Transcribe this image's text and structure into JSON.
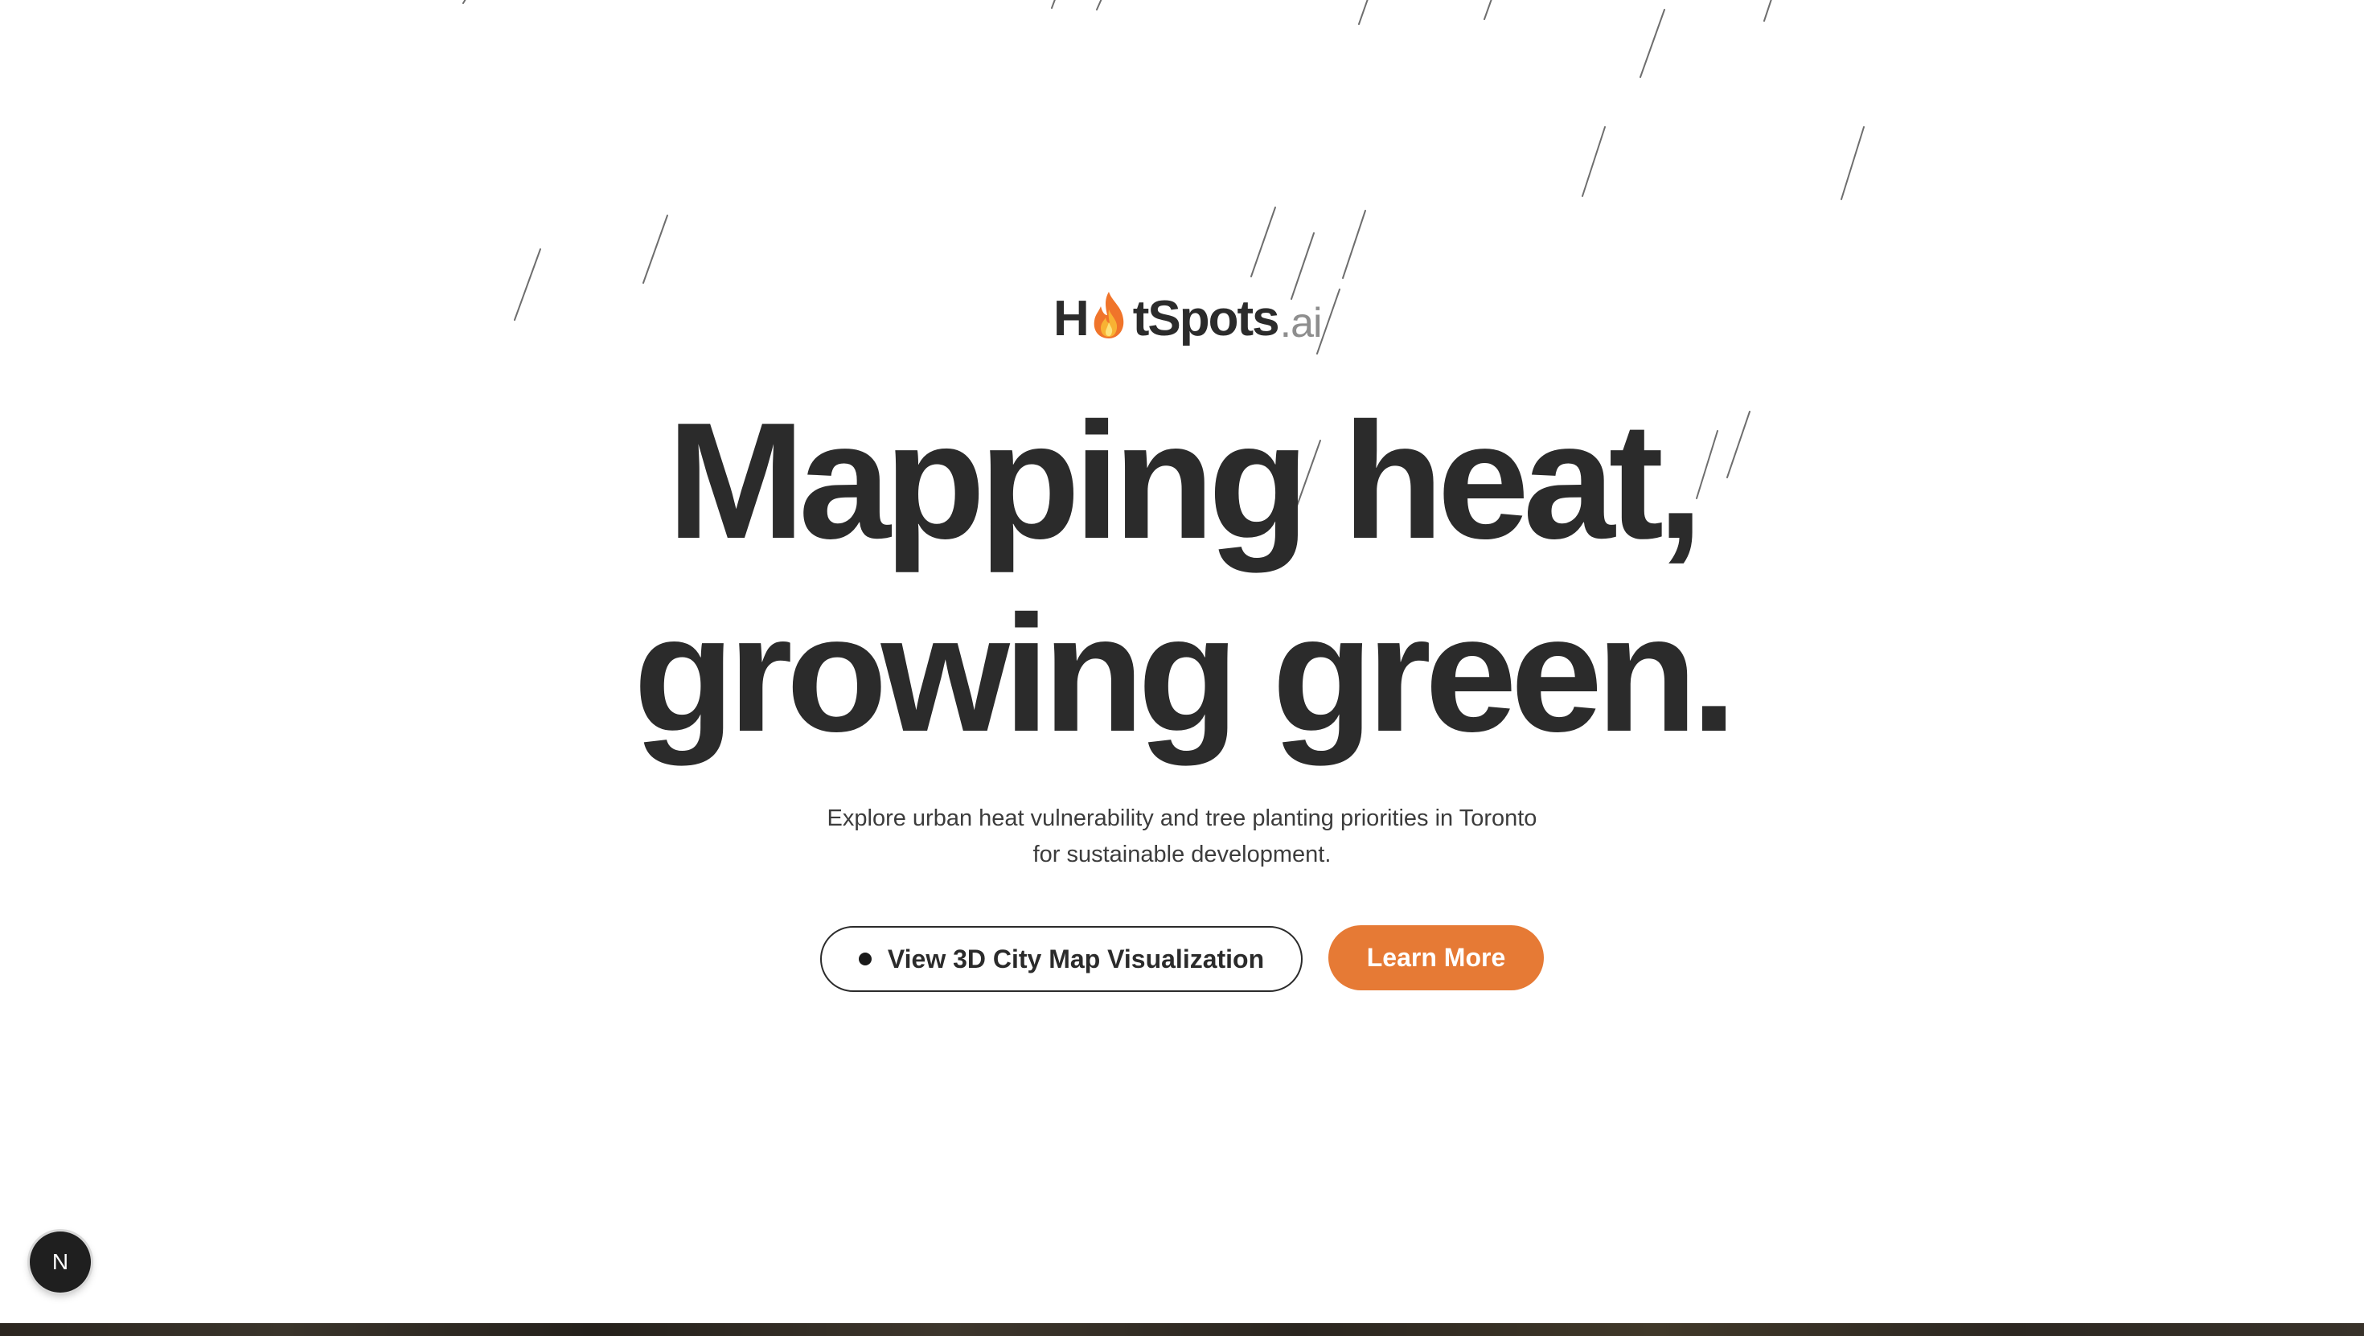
{
  "brand": {
    "logo_h": "H",
    "logo_rest": "tSpots",
    "logo_suffix": ".ai",
    "flame_icon": "flame-icon"
  },
  "hero": {
    "headline_line1": "Mapping heat,",
    "headline_line2": "growing green.",
    "subtitle_line1": "Explore urban heat vulnerability and tree planting priorities in Toronto",
    "subtitle_line2": "for sustainable development."
  },
  "actions": {
    "map_button_label": "View 3D City Map Visualization",
    "learn_more_label": "Learn More"
  },
  "colors": {
    "accent": "#e67a35",
    "text": "#2b2b2b",
    "background": "#ffffff"
  },
  "dev_badge": {
    "icon": "nextjs-n-icon",
    "letter": "N"
  }
}
